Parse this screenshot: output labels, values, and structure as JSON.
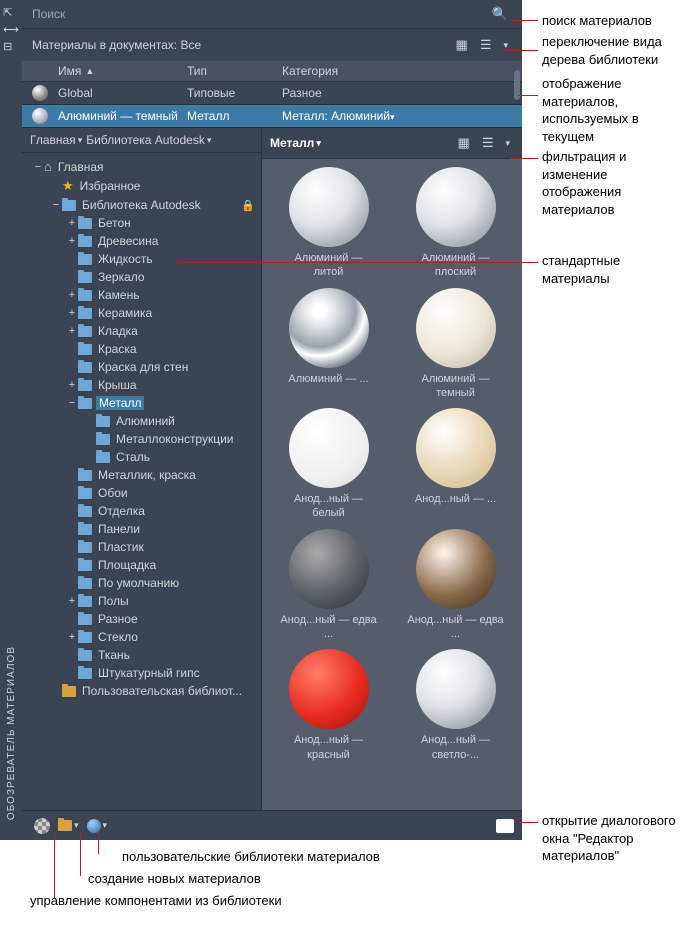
{
  "sidebar_label": "ОБОЗРЕВАТЕЛЬ МАТЕРИАЛОВ",
  "search": {
    "placeholder": "Поиск"
  },
  "doc_header": "Материалы в документах: Все",
  "table": {
    "headers": {
      "name": "Имя",
      "type": "Тип",
      "category": "Категория"
    },
    "rows": [
      {
        "name": "Global",
        "type": "Типовые",
        "category": "Разное",
        "selected": false
      },
      {
        "name": "Алюминий — темный",
        "type": "Металл",
        "category": "Металл: Алюминий",
        "selected": true
      }
    ]
  },
  "breadcrumb": {
    "home": "Главная",
    "library": "Библиотека Autodesk",
    "current": "Металл"
  },
  "tree": {
    "home": "Главная",
    "favorites": "Избранное",
    "lib": "Библиотека Autodesk",
    "nodes": [
      "Бетон",
      "Древесина",
      "Жидкость",
      "Зеркало",
      "Камень",
      "Керамика",
      "Кладка",
      "Краска",
      "Краска для стен",
      "Крыша"
    ],
    "metal": "Металл",
    "metal_children": [
      "Алюминий",
      "Металлоконструкции",
      "Сталь"
    ],
    "nodes2": [
      "Металлик, краска",
      "Обои",
      "Отделка",
      "Панели",
      "Пластик",
      "Площадка",
      "По умолчанию",
      "Полы",
      "Разное",
      "Стекло",
      "Ткань",
      "Штукатурный гипс"
    ],
    "user_lib": "Пользовательская библиот..."
  },
  "tree_expand": {
    "plus": "+",
    "minus": "−"
  },
  "thumbs": [
    {
      "label": "Алюминий — литой",
      "style": "silver"
    },
    {
      "label": "Алюминий — плоский",
      "style": "silver"
    },
    {
      "label": "Алюминий — ...",
      "style": "chrome"
    },
    {
      "label": "Алюминий — темный",
      "style": "pearl"
    },
    {
      "label": "Анод...ный — белый",
      "style": "white"
    },
    {
      "label": "Анод...ный — ...",
      "style": "beige"
    },
    {
      "label": "Анод...ный — едва ...",
      "style": "dark"
    },
    {
      "label": "Анод...ный — едва ...",
      "style": "copper"
    },
    {
      "label": "Анод...ный — красный",
      "style": "red"
    },
    {
      "label": "Анод...ный — светло-...",
      "style": "silver"
    }
  ],
  "callouts": {
    "search": "поиск материалов",
    "tree_view": "переключение вида дерева библиотеки",
    "doc_materials": "отображение материалов, используемых в текущем",
    "filter": "фильтрация и изменение отображения материалов",
    "standard": "стандартные материалы",
    "editor": "открытие диалогового окна \"Редактор материалов\"",
    "user_libs": "пользовательские библиотеки материалов",
    "new_material": "создание новых материалов",
    "lib_components": "управление компонентами из библиотеки"
  }
}
